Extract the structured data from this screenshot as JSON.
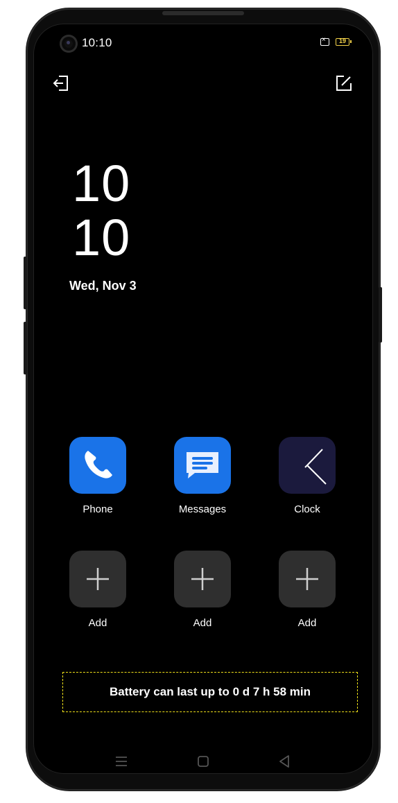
{
  "status_bar": {
    "time": "10:10",
    "battery_level": "19"
  },
  "lock_clock": {
    "hour": "10",
    "minute": "10",
    "date": "Wed, Nov 3"
  },
  "apps": [
    {
      "label": "Phone",
      "icon": "phone-icon"
    },
    {
      "label": "Messages",
      "icon": "messages-icon"
    },
    {
      "label": "Clock",
      "icon": "clock-icon"
    },
    {
      "label": "Add",
      "icon": "plus-icon"
    },
    {
      "label": "Add",
      "icon": "plus-icon"
    },
    {
      "label": "Add",
      "icon": "plus-icon"
    }
  ],
  "battery_estimate": "Battery can last up to 0 d 7 h 58 min",
  "colors": {
    "accent_blue": "#1a73e8",
    "battery_yellow": "#f4d34a",
    "highlight_border": "#f2e21a",
    "tile_gray": "#2f2f2f",
    "clock_tile": "#1b1a3d"
  }
}
